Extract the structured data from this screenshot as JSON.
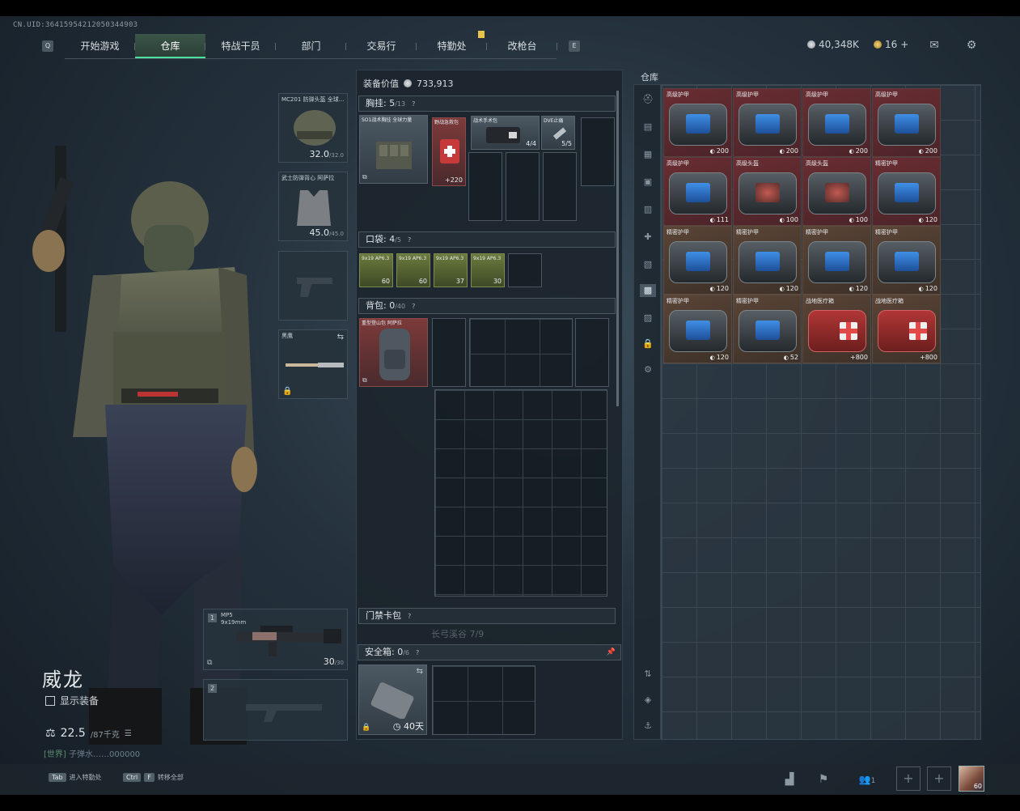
{
  "uid": "CN.UID:36415954212050344903",
  "nav": {
    "left_key": "Q",
    "right_key": "E",
    "tabs": [
      "开始游戏",
      "仓库",
      "特战干员",
      "部门",
      "交易行",
      "特勤处",
      "改枪台"
    ],
    "active_tab": "仓库"
  },
  "header": {
    "currency_silver": "40,348K",
    "currency_gold": "16",
    "gold_plus": "+",
    "mail_icon": "mail-icon",
    "settings_icon": "gear-icon"
  },
  "character": {
    "name": "威龙",
    "show_equipment_label": "显示装备",
    "weight_value": "22.5",
    "weight_max": "/87千克",
    "chat_channel": "[世界]",
    "chat_text": "子弹水……000000"
  },
  "slots": {
    "helmet": {
      "label": "MC201 防弹头盔 全球...",
      "value": "32.0",
      "max": "/32.0"
    },
    "armor": {
      "label": "武士防弹背心 阿萨拉",
      "value": "45.0",
      "max": "/45.0"
    },
    "melee": {
      "label": "黑鹰"
    },
    "primary": {
      "index": "1",
      "label": "MP5",
      "sub": "9x19mm",
      "ammo": "30",
      "ammo_max": "/30"
    },
    "secondary": {
      "index": "2"
    }
  },
  "center": {
    "equip_value_label": "装备价值",
    "equip_value": "733,913",
    "chest_rig": {
      "title": "胸挂:",
      "count": "5",
      "max": "/13",
      "help": "?"
    },
    "chest_item": {
      "label": "SO1战术胸挂 全球力量"
    },
    "chest_contents": [
      {
        "label": "野战急救包",
        "value": "+220"
      },
      {
        "label": "战术手术包",
        "value": "4/4"
      },
      {
        "label": "DVE止痛",
        "value": "5/5"
      }
    ],
    "pockets": {
      "title": "口袋:",
      "count": "4",
      "max": "/5",
      "help": "?"
    },
    "pocket_items": [
      {
        "label": "9x19 AP6.3",
        "value": "60"
      },
      {
        "label": "9x19 AP6.3",
        "value": "60"
      },
      {
        "label": "9x19 AP6.3",
        "value": "37"
      },
      {
        "label": "9x19 AP6.3",
        "value": "30"
      }
    ],
    "backpack": {
      "title": "背包:",
      "count": "0",
      "max": "/40",
      "help": "?"
    },
    "backpack_item": {
      "label": "重型登山包 阿萨拉"
    },
    "keycard": {
      "title": "门禁卡包",
      "help": "?"
    },
    "faded_text": "长弓溪谷 7/9",
    "safebox": {
      "title": "安全箱:",
      "count": "0",
      "max": "/6",
      "help": "?",
      "time": "40天"
    }
  },
  "stash": {
    "title": "仓库",
    "items": [
      {
        "name": "高级护甲",
        "dur": "200",
        "style": "red",
        "screen": "blue"
      },
      {
        "name": "高级护甲",
        "dur": "200",
        "style": "red",
        "screen": "blue"
      },
      {
        "name": "高级护甲",
        "dur": "200",
        "style": "red",
        "screen": "blue"
      },
      {
        "name": "高级护甲",
        "dur": "200",
        "style": "red",
        "screen": "blue"
      },
      {
        "name": "高级护甲",
        "dur": "111",
        "style": "red",
        "screen": "blue"
      },
      {
        "name": "高级头盔",
        "dur": "100",
        "style": "red",
        "screen": "redscreen"
      },
      {
        "name": "高级头盔",
        "dur": "100",
        "style": "red",
        "screen": "redscreen"
      },
      {
        "name": "精密护甲",
        "dur": "120",
        "style": "red",
        "screen": "blue"
      },
      {
        "name": "精密护甲",
        "dur": "120",
        "style": "brown",
        "screen": "blue"
      },
      {
        "name": "精密护甲",
        "dur": "120",
        "style": "brown",
        "screen": "blue"
      },
      {
        "name": "精密护甲",
        "dur": "120",
        "style": "brown",
        "screen": "blue"
      },
      {
        "name": "精密护甲",
        "dur": "120",
        "style": "brown",
        "screen": "blue"
      },
      {
        "name": "精密护甲",
        "dur": "120",
        "style": "brown",
        "screen": "blue"
      },
      {
        "name": "精密护甲",
        "dur": "52",
        "style": "brown",
        "screen": "blue"
      },
      {
        "name": "战地医疗箱",
        "dur": "+800",
        "style": "brown",
        "screen": "med"
      },
      {
        "name": "战地医疗箱",
        "dur": "+800",
        "style": "brown",
        "screen": "med"
      }
    ]
  },
  "bottom": {
    "tab_key": "Tab",
    "tab_action": "进入特勤处",
    "ctrl_key": "Ctrl",
    "f_key": "F",
    "ctrl_action": "转移全部",
    "team_count": "1",
    "avatar_badge": "60"
  },
  "colors": {
    "accent": "#4ee0a0",
    "gold": "#e8c34a"
  }
}
